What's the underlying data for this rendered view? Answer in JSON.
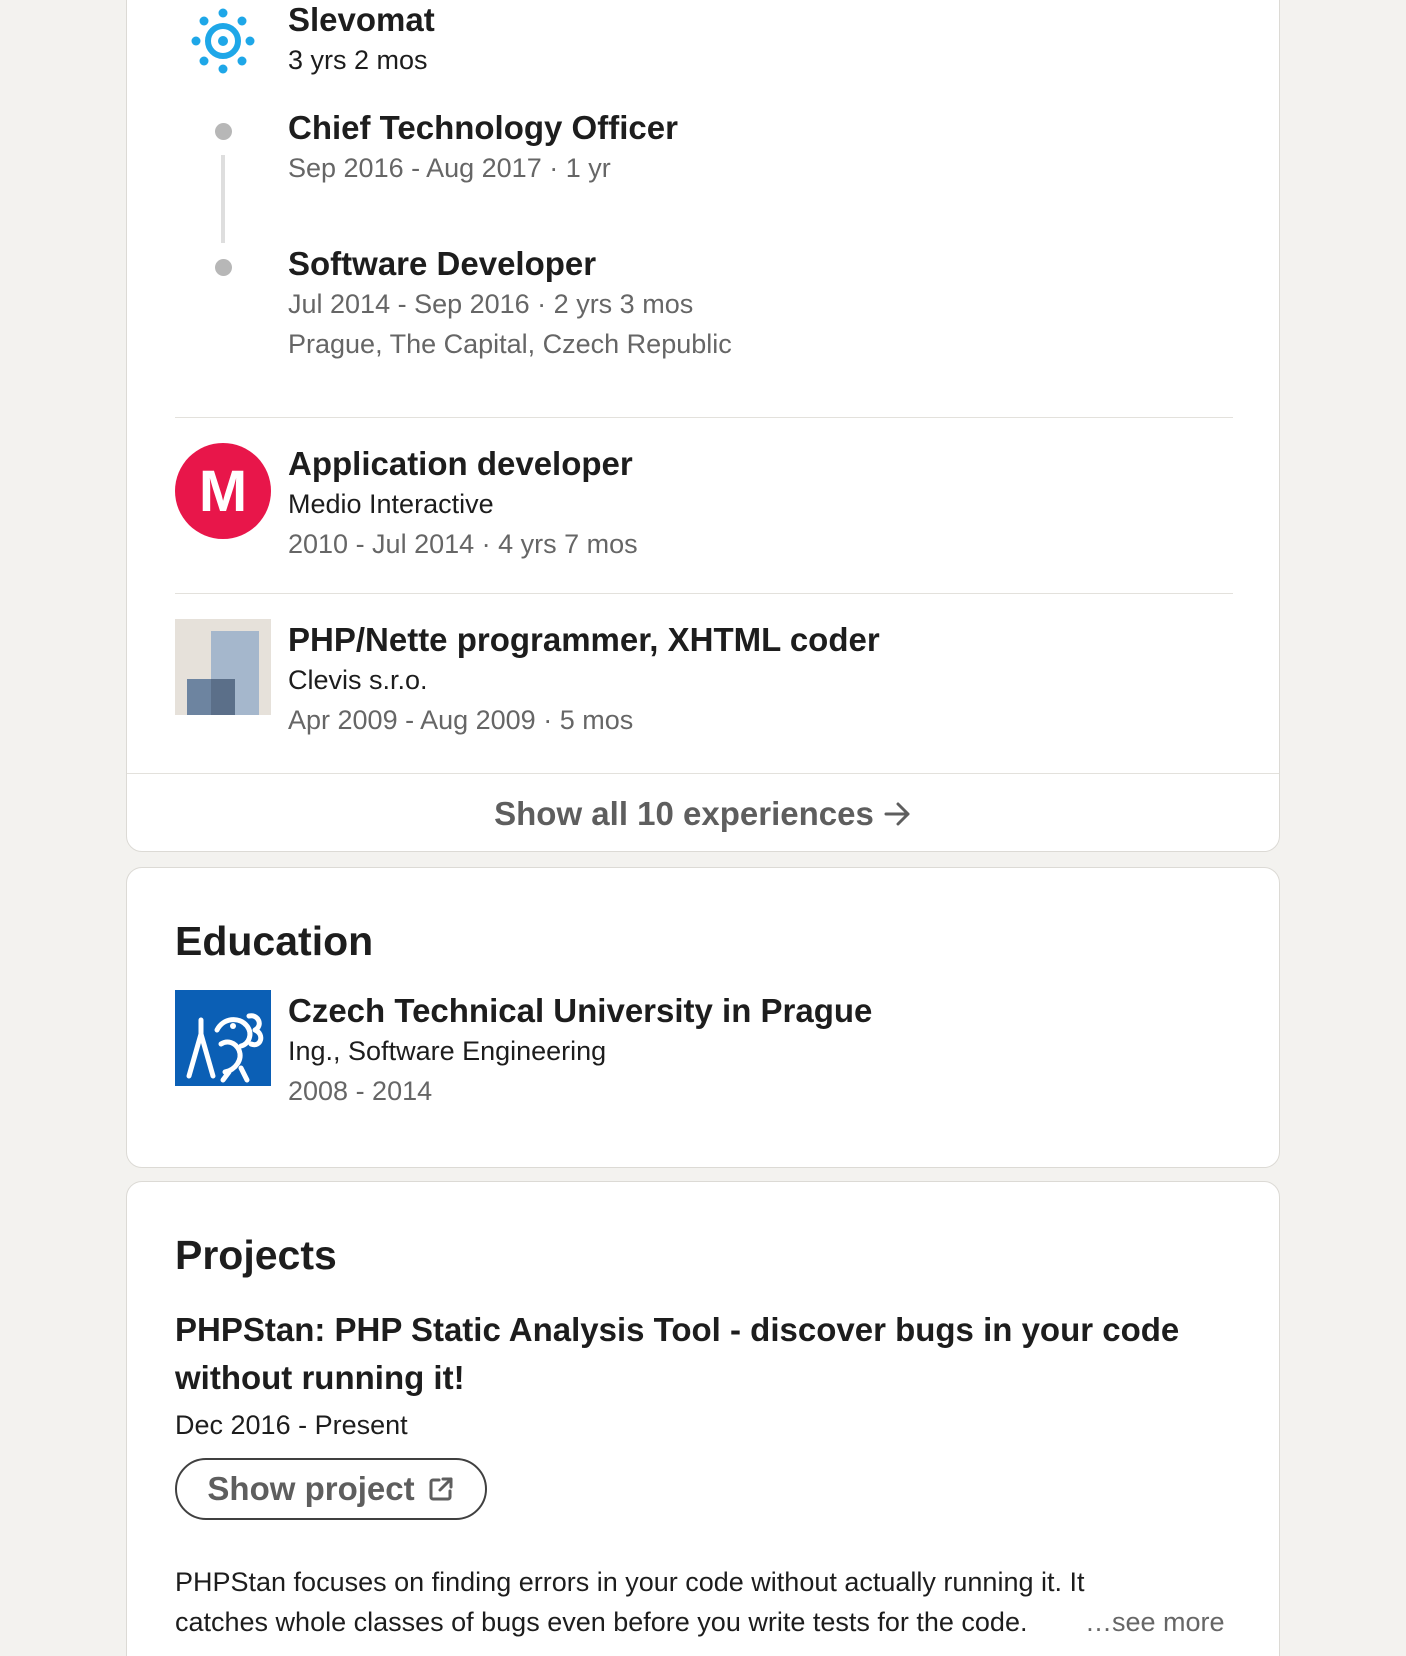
{
  "experience": {
    "groups": [
      {
        "company": "Slevomat",
        "duration": "3 yrs 2 mos",
        "logo_icon": "slevomat-gear-logo",
        "roles": [
          {
            "title": "Chief Technology Officer",
            "dates": "Sep 2016 - Aug 2017 · 1 yr",
            "location": ""
          },
          {
            "title": "Software Developer",
            "dates": "Jul 2014 - Sep 2016 · 2 yrs 3 mos",
            "location": "Prague, The Capital, Czech Republic"
          }
        ]
      }
    ],
    "items": [
      {
        "title": "Application developer",
        "company": "Medio Interactive",
        "dates": "2010 - Jul 2014 · 4 yrs 7 mos",
        "logo_icon": "medio-m-logo",
        "logo_letter": "M"
      },
      {
        "title": "PHP/Nette programmer, XHTML coder",
        "company": "Clevis s.r.o.",
        "dates": "Apr 2009 - Aug 2009 · 5 mos",
        "logo_icon": "placeholder-company-logo"
      }
    ],
    "show_all_label": "Show all 10 experiences",
    "show_all_icon": "arrow-right-icon"
  },
  "education": {
    "heading": "Education",
    "items": [
      {
        "school": "Czech Technical University in Prague",
        "degree": "Ing., Software Engineering",
        "dates": "2008 - 2014",
        "logo_icon": "cvut-lion-logo"
      }
    ]
  },
  "projects": {
    "heading": "Projects",
    "items": [
      {
        "title": "PHPStan: PHP Static Analysis Tool - discover bugs in your code without running it!",
        "dates": "Dec 2016 - Present",
        "button_label": "Show project",
        "button_icon": "external-link-icon",
        "description_line1": "PHPStan focuses on finding errors in your code without actually running it. It",
        "description_line2": "catches whole classes of bugs even before you write tests for the code.",
        "see_more_label": "…see more"
      }
    ]
  },
  "colors": {
    "page_bg": "#f3f2ef",
    "card_bg": "#ffffff",
    "slevomat_blue": "#1ea7e8",
    "medio_red": "#e8164a",
    "cvut_blue": "#0b5fb5"
  }
}
